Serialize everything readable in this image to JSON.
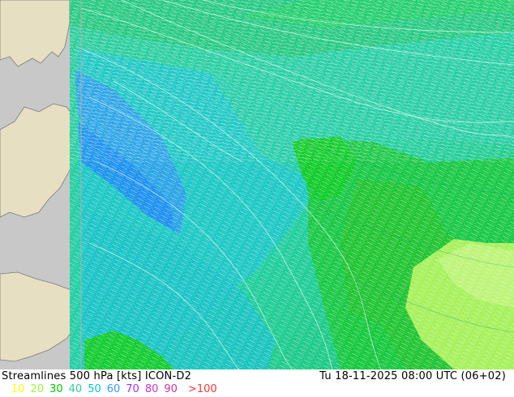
{
  "map": {
    "title": "Streamlines 500 hPa [kts] ICON-D2",
    "valid_time": "Tu 18-11-2025 08:00 UTC (06+02)",
    "legend": [
      {
        "label": "10",
        "color": "#ffff00"
      },
      {
        "label": "20",
        "color": "#99ff33"
      },
      {
        "label": "30",
        "color": "#00cc00"
      },
      {
        "label": "40",
        "color": "#33cc99"
      },
      {
        "label": "50",
        "color": "#00cccc"
      },
      {
        "label": "60",
        "color": "#3399ff"
      },
      {
        "label": "70",
        "color": "#9933ff"
      },
      {
        "label": "80",
        "color": "#cc33cc"
      },
      {
        "label": "90",
        "color": "#cc3399"
      },
      {
        "label": ">100",
        "color": "#ff3333"
      }
    ],
    "colors": {
      "land": "#e6dfc2",
      "outside_domain": "#c8c8c8",
      "coast": "#7a7a7a"
    }
  }
}
